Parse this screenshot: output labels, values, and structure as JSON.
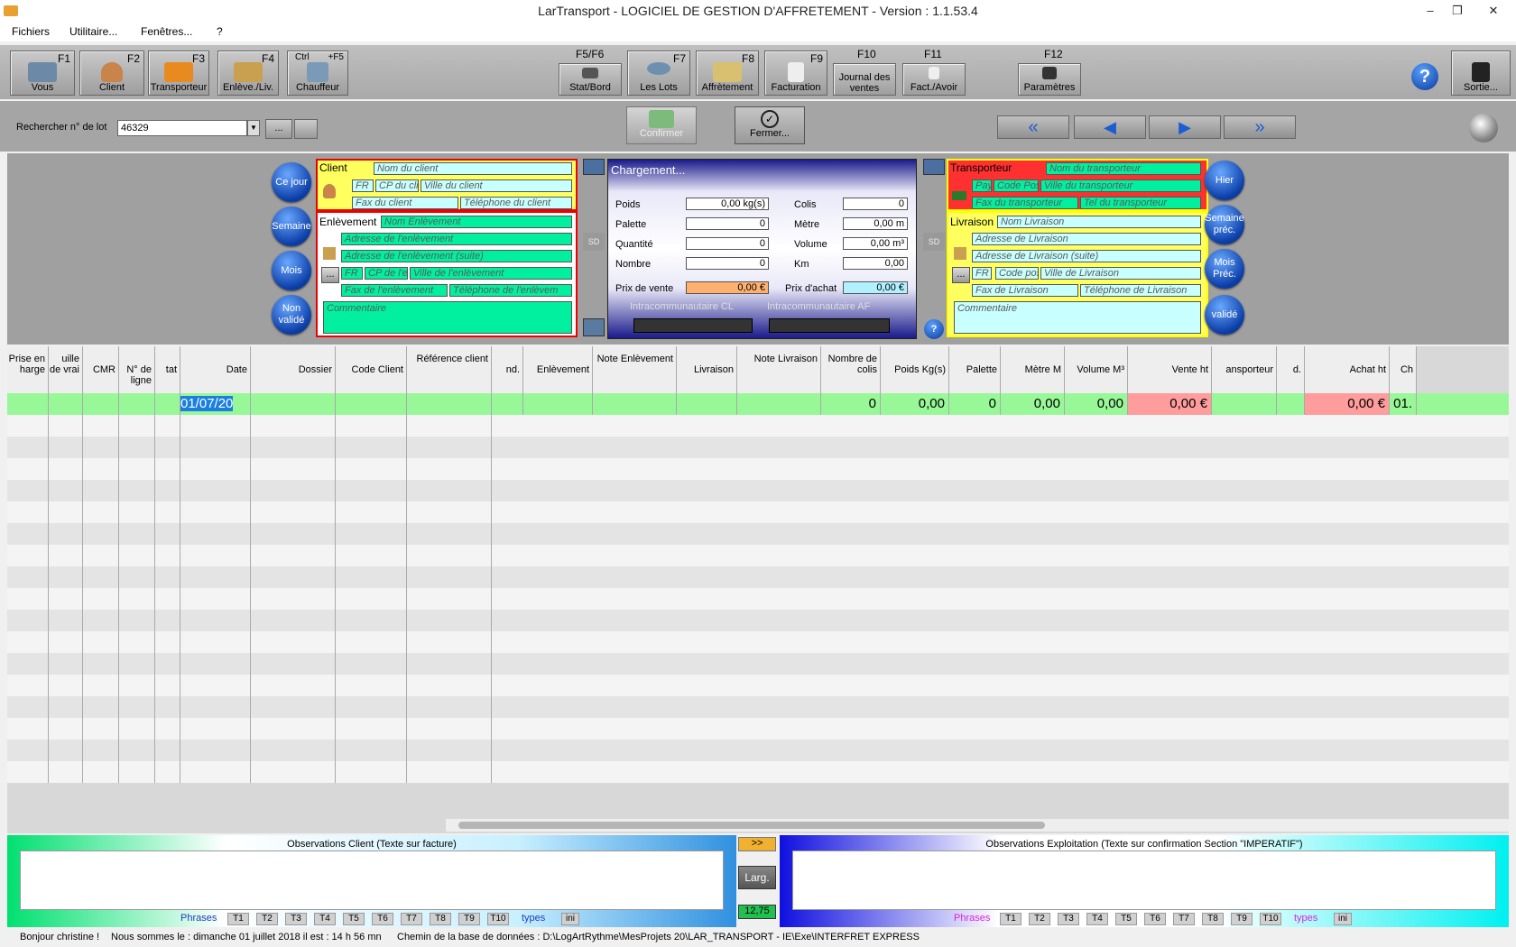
{
  "window": {
    "title": "LarTransport - LOGICIEL DE GESTION D'AFFRETEMENT - Version : 1.1.53.4",
    "min": "–",
    "max": "❐",
    "close": "✕"
  },
  "menu": [
    "Fichiers",
    "Utilitaire...",
    "Fenêtres...",
    "?"
  ],
  "toolbar": {
    "vous": {
      "key": "F1",
      "label": "Vous"
    },
    "client": {
      "key": "F2",
      "label": "Client"
    },
    "transporteur": {
      "key": "F3",
      "label": "Transporteur"
    },
    "enleve": {
      "key": "F4",
      "label": "Enlève./Liv."
    },
    "chauffeur": {
      "keyl": "Ctrl",
      "key": "+F5",
      "label": "Chauffeur"
    },
    "stat": {
      "fkey": "F5/F6",
      "label": "Stat/Bord"
    },
    "lots": {
      "key": "F7",
      "label": "Les Lots"
    },
    "affretement": {
      "key": "F8",
      "label": "Affrètement"
    },
    "facturation": {
      "key": "F9",
      "label": "Facturation"
    },
    "journal": {
      "fkey": "F10",
      "label": "Journal des ventes"
    },
    "factavoir": {
      "fkey": "F11",
      "label": "Fact./Avoir"
    },
    "parametres": {
      "fkey": "F12",
      "label": "Paramètres"
    },
    "help": "?",
    "sortie": {
      "label": "Sortie..."
    }
  },
  "search": {
    "label": "Rechercher n° de lot",
    "value": "46329",
    "more": "...",
    "confirm": "Confirmer",
    "close": "Fermer..."
  },
  "left_buttons": [
    "Ce jour",
    "Semaine",
    "Mois",
    "Non validé"
  ],
  "right_buttons": [
    "Hier",
    "Semaine préc.",
    "Mois Préc.",
    "validé"
  ],
  "client": {
    "title": "Client",
    "nom": "Nom du client",
    "pays": "FR",
    "cp": "CP du cli",
    "ville": "Ville du client",
    "fax": "Fax du client",
    "tel": "Téléphone du client"
  },
  "enlevement": {
    "title": "Enlèvement",
    "nom": "Nom Enlèvement",
    "adr": "Adresse de l'enlèvement",
    "adr2": "Adresse de l'enlèvement (suite)",
    "pays": "FR",
    "cp": "CP de l'e",
    "ville": "Ville de l'enlèvement",
    "fax": "Fax de l'enlèvement",
    "tel": "Téléphone de l'enlèvem",
    "comment": "Commentaire",
    "btn": "..."
  },
  "chargement": {
    "title": "Chargement...",
    "poids_l": "Poids",
    "poids": "0,00 kg(s)",
    "colis_l": "Colis",
    "colis": "0",
    "palette_l": "Palette",
    "palette": "0",
    "metre_l": "Mètre",
    "metre": "0,00 m",
    "quantite_l": "Quantité",
    "quantite": "0",
    "volume_l": "Volume",
    "volume": "0,00 m³",
    "nombre_l": "Nombre",
    "nombre": "0",
    "km_l": "Km",
    "km": "0,00",
    "pv_l": "Prix de vente",
    "pv": "0,00 €",
    "pa_l": "Prix d'achat",
    "pa": "0,00 €",
    "intra_cl": "Intracommunautaire CL",
    "intra_af": "Intracommunautaire AF",
    "sd": "SD"
  },
  "transporteur": {
    "title": "Transporteur",
    "nom": "Nom du transporteur",
    "pays": "Pay",
    "cp": "Code Pos",
    "ville": "Ville du transporteur",
    "fax": "Fax du transporteur",
    "tel": "Tel du transporteur"
  },
  "livraison": {
    "title": "Livraison",
    "nom": "Nom Livraison",
    "adr": "Adresse de Livraison",
    "adr2": "Adresse de Livraison (suite)",
    "pays": "FR",
    "cp": "Code pos",
    "ville": "Ville de Livraison",
    "fax": "Fax  de Livraison",
    "tel": "Téléphone de Livraison",
    "comment": "Commentaire",
    "btn": "..."
  },
  "columns": [
    "Prise en charge",
    "Feuille de voiture",
    "CMR",
    "N° de ligne",
    "Etat",
    "Date",
    "Dossier",
    "Code Client",
    "Référence client",
    "Ind.",
    "Enlèvement",
    "Note Enlèvement",
    "Livraison",
    "Note Livraison",
    "Nombre de colis",
    "Poids Kg(s)",
    "Palette",
    "Mètre M",
    "Volume M³",
    "Vente ht",
    "Transporteur",
    "Ind.",
    "Achat ht",
    "Ch"
  ],
  "col_display": [
    "Prise en harge",
    "uille de vrai",
    "CMR",
    "N° de ligne",
    "tat",
    "Date",
    "Dossier",
    "Code Client",
    "Référence client",
    "nd.",
    "Enlèvement",
    "Note Enlèvement",
    "Livraison",
    "Note Livraison",
    "Nombre de colis",
    "Poids Kg(s)",
    "Palette",
    "Mètre M",
    "Volume M³",
    "Vente ht",
    "ansporteur",
    "d.",
    "Achat ht",
    "Ch"
  ],
  "row1": {
    "date": "01/07/20",
    "colis": "0",
    "poids": "0,00",
    "palette": "0",
    "metre": "0,00",
    "volume": "0,00",
    "vente": "0,00 €",
    "achat": "0,00 €",
    "ch": "01."
  },
  "obs": {
    "client_title": "Observations Client (Texte sur facture)",
    "expl_title": "Observations Exploitation (Texte sur confirmation Section \"IMPERATIF\")",
    "arrow": ">>",
    "larg": "Larg.",
    "larg_val": "12,75",
    "phrases": "Phrases",
    "types": "types",
    "ini": "ini",
    "tabs": [
      "T1",
      "T2",
      "T3",
      "T4",
      "T5",
      "T6",
      "T7",
      "T8",
      "T9",
      "T10"
    ]
  },
  "status": {
    "hello": "Bonjour christine !",
    "date": "Nous sommes le : dimanche  01 juillet 2018  il est : 14 h 56 mn",
    "path": "Chemin de la base de données : D:\\LogArtRythme\\MesProjets 20\\LAR_TRANSPORT - IE\\Exe\\INTERFRET EXPRESS"
  }
}
